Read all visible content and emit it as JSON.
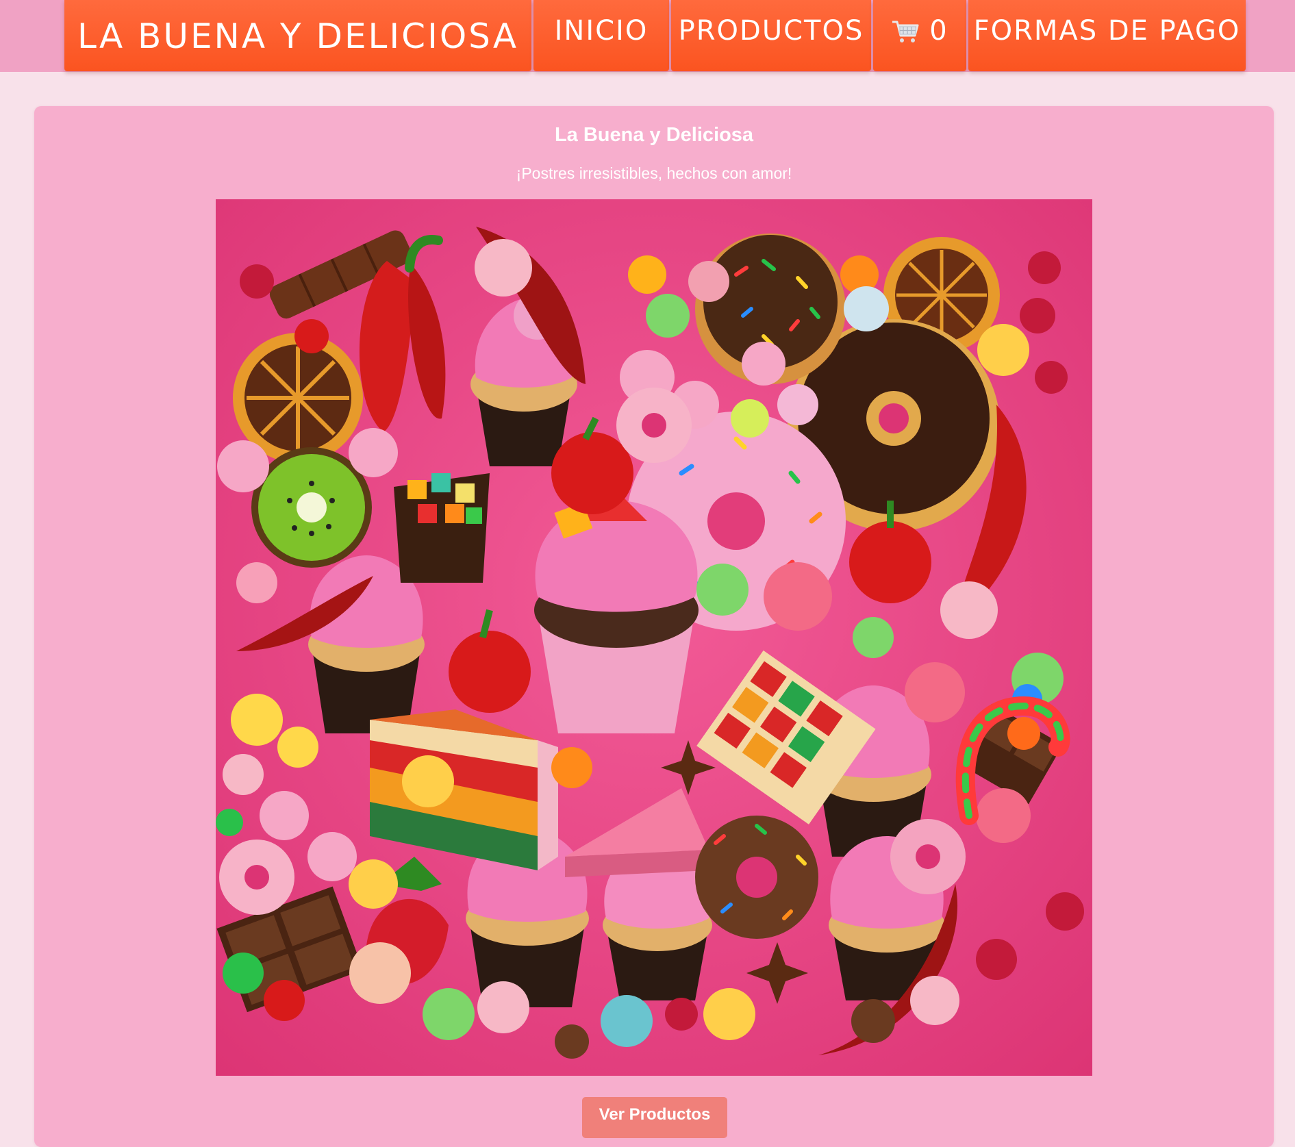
{
  "nav": {
    "brand": "LA BUENA Y DELICIOSA",
    "inicio": "INICIO",
    "productos": "PRODUCTOS",
    "cart_count": "0",
    "cart_icon": "shopping-cart-icon",
    "formas_pago": "FORMAS DE PAGO"
  },
  "hero": {
    "title": "La Buena y Deliciosa",
    "subtitle": "¡Postres irresistibles, hechos con amor!",
    "cta_label": "Ver Productos"
  },
  "colors": {
    "nav_orange": "#fb5420",
    "top_strip": "#f0a2c4",
    "page_bg": "#f8e1ea",
    "card_bg": "#f7aecd",
    "button": "#f0807a",
    "image_bg": "#e8427f"
  }
}
